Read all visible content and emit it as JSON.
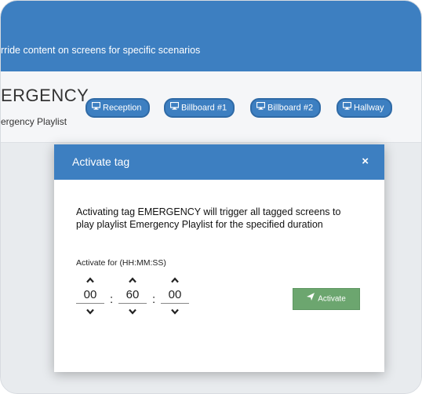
{
  "banner": {
    "subtitle": "rride content on screens for specific scenarios"
  },
  "tag": {
    "name": "ERGENCY",
    "playlist": "ergency Playlist"
  },
  "screens": [
    {
      "label": "Reception",
      "icon": "monitor-icon"
    },
    {
      "label": "Billboard #1",
      "icon": "monitor-icon"
    },
    {
      "label": "Billboard #2",
      "icon": "monitor-icon"
    },
    {
      "label": "Hallway",
      "icon": "monitor-icon"
    }
  ],
  "modal": {
    "title": "Activate tag",
    "close": "×",
    "message": "Activating tag EMERGENCY will trigger all tagged screens to play playlist Emergency Playlist for the specified duration",
    "duration_label": "Activate for (HH:MM:SS)",
    "hours": "00",
    "minutes": "60",
    "seconds": "00",
    "separator": ":",
    "activate_label": "Activate"
  },
  "colors": {
    "primary": "#3d7fc1",
    "activate": "#6ca66f"
  }
}
